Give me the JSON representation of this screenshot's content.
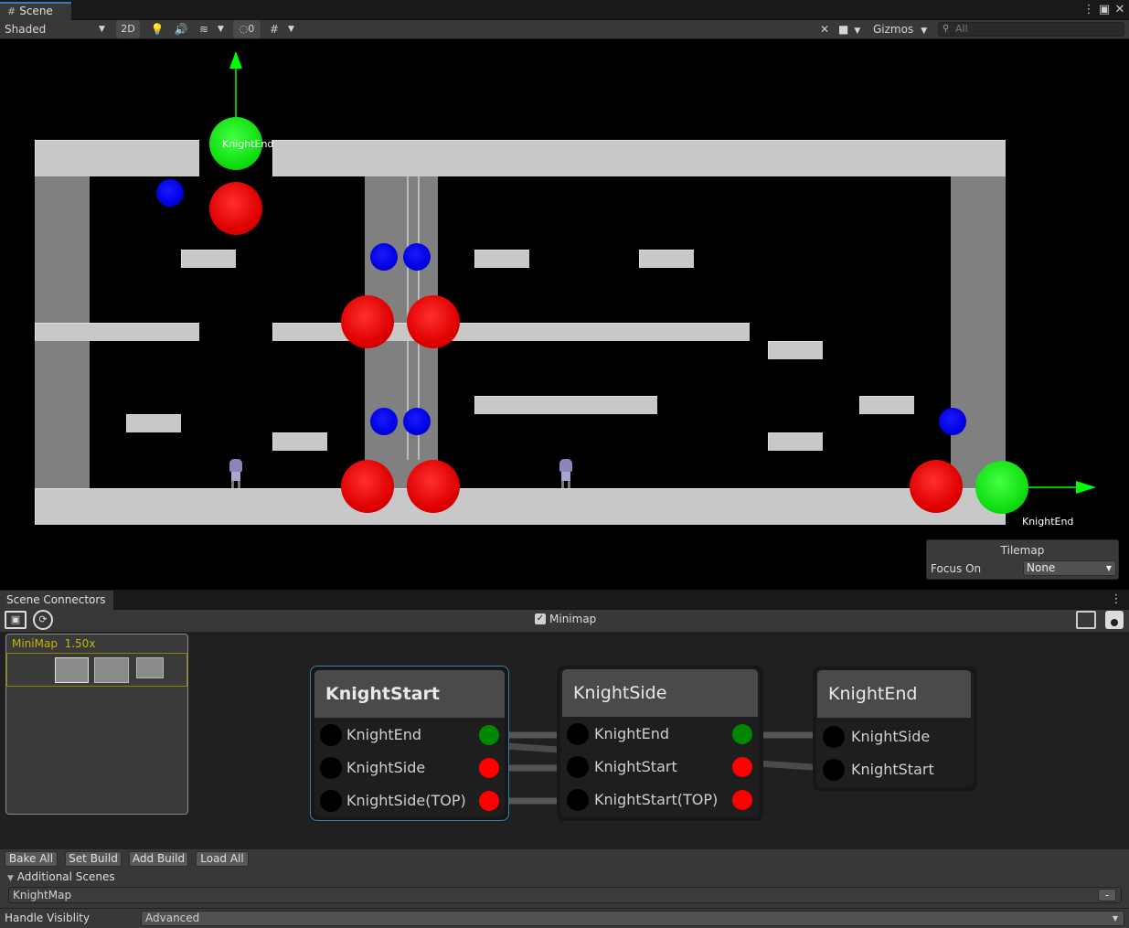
{
  "window": {
    "tab_label": "Scene",
    "menu_icon": "kebab-menu-icon",
    "maximize_icon": "maximize-icon",
    "close_icon": "close-icon"
  },
  "toolbar": {
    "shading_mode": "Shaded",
    "mode_2d_label": "2D",
    "hidden_count": "0",
    "gizmos_label": "Gizmos",
    "search_placeholder": "All"
  },
  "scene": {
    "labels": {
      "knight_end_top": "KnightEnd",
      "knight_end_right": "KnightEnd"
    },
    "colors": {
      "background": "#000000",
      "platform": "#c8c8c8",
      "wall": "#808080",
      "red_marker": "#ff0000",
      "blue_marker": "#0000ff",
      "green_marker": "#00ff00",
      "gizmo_arrow": "#00ff00"
    }
  },
  "tilemap_overlay": {
    "title": "Tilemap",
    "focus_label": "Focus On",
    "focus_value": "None"
  },
  "connectors": {
    "tab_label": "Scene Connectors",
    "minimap_checkbox_label": "Minimap",
    "minimap_checked": true,
    "minimap": {
      "title": "MiniMap",
      "zoom": "1.50x"
    },
    "nodes": [
      {
        "title": "KnightStart",
        "selected": true,
        "ports": [
          {
            "label": "KnightEnd",
            "color": "#008800"
          },
          {
            "label": "KnightSide",
            "color": "#ff0000"
          },
          {
            "label": "KnightSide(TOP)",
            "color": "#ff0000"
          }
        ]
      },
      {
        "title": "KnightSide",
        "selected": false,
        "ports": [
          {
            "label": "KnightEnd",
            "color": "#008800"
          },
          {
            "label": "KnightStart",
            "color": "#ff0000"
          },
          {
            "label": "KnightStart(TOP)",
            "color": "#ff0000"
          }
        ]
      },
      {
        "title": "KnightEnd",
        "selected": false,
        "ports": [
          {
            "label": "KnightSide"
          },
          {
            "label": "KnightStart"
          }
        ]
      }
    ]
  },
  "bottom": {
    "buttons": [
      "Bake All",
      "Set Build",
      "Add Build",
      "Load All"
    ],
    "additional_scenes_label": "Additional Scenes",
    "scene_entry": "KnightMap",
    "remove_label": "-",
    "handle_visibility_label": "Handle Visiblity",
    "handle_visibility_value": "Advanced"
  }
}
